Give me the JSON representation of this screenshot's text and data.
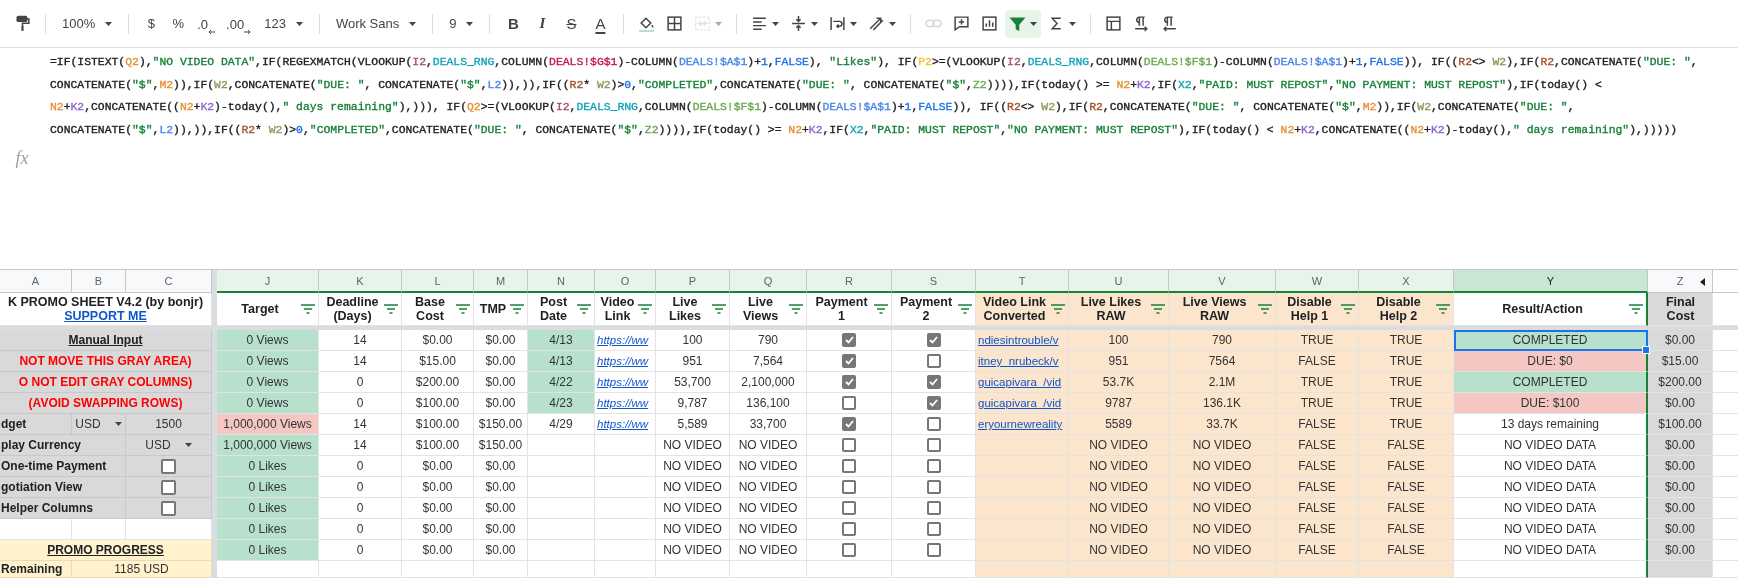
{
  "toolbar": [
    [
      {
        "kind": "paint-format"
      }
    ],
    [
      {
        "kind": "dropdown",
        "label": "100%"
      }
    ],
    [
      {
        "kind": "text",
        "label": "$"
      },
      {
        "kind": "text",
        "label": "%"
      },
      {
        "kind": "decimal-decrease",
        "label": ".0"
      },
      {
        "kind": "decimal-increase",
        "label": ".00"
      },
      {
        "kind": "dropdown",
        "label": "123"
      }
    ],
    [
      {
        "kind": "dropdown",
        "label": "Work Sans"
      }
    ],
    [
      {
        "kind": "dropdown",
        "label": "9"
      }
    ],
    [
      {
        "kind": "bold",
        "label": "B"
      },
      {
        "kind": "italic",
        "label": "I"
      },
      {
        "kind": "strike",
        "label": "S"
      },
      {
        "kind": "text-color",
        "label": "A"
      }
    ],
    [
      {
        "kind": "fill",
        "menu": false,
        "disabled": false
      },
      {
        "kind": "borders",
        "menu": false,
        "disabled": false
      },
      {
        "kind": "merge",
        "menu": true,
        "disabled": true
      }
    ],
    [
      {
        "kind": "align",
        "menu": true,
        "disabled": false
      },
      {
        "kind": "valign",
        "menu": true,
        "disabled": false
      },
      {
        "kind": "wrap",
        "menu": true,
        "disabled": false
      },
      {
        "kind": "rotate",
        "menu": true,
        "disabled": false
      }
    ],
    [
      {
        "kind": "link",
        "menu": false,
        "disabled": true,
        "active": false
      },
      {
        "kind": "comment",
        "menu": false,
        "disabled": false,
        "active": false
      },
      {
        "kind": "chart",
        "menu": false,
        "disabled": false,
        "active": false
      },
      {
        "kind": "filter",
        "menu": true,
        "disabled": false,
        "active": true
      },
      {
        "kind": "sigma",
        "menu": true,
        "disabled": false,
        "active": false
      }
    ],
    [
      {
        "kind": "columns"
      },
      {
        "kind": "ltr"
      },
      {
        "kind": "rtl"
      }
    ]
  ],
  "formula_bar": {
    "label": "fx",
    "lines": [
      [
        {
          "text": "=IF(ISTEXT("
        },
        {
          "text": "Q2",
          "color": "#e69138"
        },
        {
          "text": "),"
        },
        {
          "text": "\"NO VIDEO DATA\"",
          "color": "#188038"
        },
        {
          "text": ",IF(REGEXMATCH(VLOOKUP("
        },
        {
          "text": "I2",
          "color": "#a64d79"
        },
        {
          "text": ","
        },
        {
          "text": "DEALS_RNG",
          "color": "#12a4b8"
        },
        {
          "text": ",COLUMN("
        },
        {
          "text": "DEALS!$G$1",
          "color": "#c2185b"
        },
        {
          "text": ")-COLUMN("
        },
        {
          "text": "DEALS!$A$1",
          "color": "#4a86e8"
        },
        {
          "text": ")+"
        },
        {
          "text": "1",
          "color": "#1a73e8"
        },
        {
          "text": ","
        },
        {
          "text": "FALSE",
          "color": "#1a73e8"
        },
        {
          "text": "), "
        },
        {
          "text": "\"Likes\"",
          "color": "#188038"
        },
        {
          "text": "), IF("
        },
        {
          "text": "P2",
          "color": "#f1c232"
        },
        {
          "text": ">=(VLOOKUP("
        },
        {
          "text": "I2",
          "color": "#a64d79"
        },
        {
          "text": ","
        },
        {
          "text": "DEALS_RNG",
          "color": "#12a4b8"
        },
        {
          "text": ",COLUMN("
        },
        {
          "text": "DEALS!$F$1",
          "color": "#6aa84f"
        },
        {
          "text": ")-COLUMN("
        },
        {
          "text": "DEALS!$A$1",
          "color": "#4a86e8"
        },
        {
          "text": ")+"
        },
        {
          "text": "1",
          "color": "#1a73e8"
        },
        {
          "text": ","
        },
        {
          "text": "FALSE",
          "color": "#1a73e8"
        },
        {
          "text": ")), IF(("
        },
        {
          "text": "R2",
          "color": "#a0522d"
        },
        {
          "text": "<> "
        },
        {
          "text": "W2",
          "color": "#8a9a5b"
        },
        {
          "text": "),IF("
        },
        {
          "text": "R2",
          "color": "#a0522d"
        },
        {
          "text": ",CONCATENATE("
        },
        {
          "text": "\"DUE: \"",
          "color": "#188038"
        },
        {
          "text": ","
        }
      ],
      [
        {
          "text": "CONCATENATE("
        },
        {
          "text": "\"$\"",
          "color": "#188038"
        },
        {
          "text": ","
        },
        {
          "text": "M2",
          "color": "#e69138"
        },
        {
          "text": ")),IF("
        },
        {
          "text": "W2",
          "color": "#8a9a5b"
        },
        {
          "text": ",CONCATENATE("
        },
        {
          "text": "\"DUE: \"",
          "color": "#188038"
        },
        {
          "text": ", CONCATENATE("
        },
        {
          "text": "\"$\"",
          "color": "#188038"
        },
        {
          "text": ","
        },
        {
          "text": "L2",
          "color": "#4a86e8"
        },
        {
          "text": ")),)),IF(("
        },
        {
          "text": "R2",
          "color": "#a0522d"
        },
        {
          "text": "* "
        },
        {
          "text": "W2",
          "color": "#8a9a5b"
        },
        {
          "text": ")>"
        },
        {
          "text": "0",
          "color": "#1a73e8"
        },
        {
          "text": ","
        },
        {
          "text": "\"COMPLETED\"",
          "color": "#188038"
        },
        {
          "text": ",CONCATENATE("
        },
        {
          "text": "\"DUE: \"",
          "color": "#188038"
        },
        {
          "text": ", CONCATENATE("
        },
        {
          "text": "\"$\"",
          "color": "#188038"
        },
        {
          "text": ","
        },
        {
          "text": "Z2",
          "color": "#6aa84f"
        },
        {
          "text": ")))),IF(today() >= "
        },
        {
          "text": "N2",
          "color": "#e69138"
        },
        {
          "text": "+"
        },
        {
          "text": "K2",
          "color": "#8e63ce"
        },
        {
          "text": ",IF("
        },
        {
          "text": "X2",
          "color": "#12a4b8"
        },
        {
          "text": ","
        },
        {
          "text": "\"PAID: MUST REPOST\"",
          "color": "#188038"
        },
        {
          "text": ","
        },
        {
          "text": "\"NO PAYMENT: MUST REPOST\"",
          "color": "#188038"
        },
        {
          "text": "),IF(today() <"
        }
      ],
      [
        {
          "text": "N2",
          "color": "#e69138"
        },
        {
          "text": "+"
        },
        {
          "text": "K2",
          "color": "#8e63ce"
        },
        {
          "text": ",CONCATENATE(("
        },
        {
          "text": "N2",
          "color": "#e69138"
        },
        {
          "text": "+"
        },
        {
          "text": "K2",
          "color": "#8e63ce"
        },
        {
          "text": ")-today(),"
        },
        {
          "text": "\" days remaining\"",
          "color": "#188038"
        },
        {
          "text": "),))), IF("
        },
        {
          "text": "Q2",
          "color": "#e69138"
        },
        {
          "text": ">=(VLOOKUP("
        },
        {
          "text": "I2",
          "color": "#a64d79"
        },
        {
          "text": ","
        },
        {
          "text": "DEALS_RNG",
          "color": "#12a4b8"
        },
        {
          "text": ",COLUMN("
        },
        {
          "text": "DEALS!$F$1",
          "color": "#6aa84f"
        },
        {
          "text": ")-COLUMN("
        },
        {
          "text": "DEALS!$A$1",
          "color": "#4a86e8"
        },
        {
          "text": ")+"
        },
        {
          "text": "1",
          "color": "#1a73e8"
        },
        {
          "text": ","
        },
        {
          "text": "FALSE",
          "color": "#1a73e8"
        },
        {
          "text": ")), IF(("
        },
        {
          "text": "R2",
          "color": "#a0522d"
        },
        {
          "text": "<> "
        },
        {
          "text": "W2",
          "color": "#8a9a5b"
        },
        {
          "text": "),IF("
        },
        {
          "text": "R2",
          "color": "#a0522d"
        },
        {
          "text": ",CONCATENATE("
        },
        {
          "text": "\"DUE: \"",
          "color": "#188038"
        },
        {
          "text": ", CONCATENATE("
        },
        {
          "text": "\"$\"",
          "color": "#188038"
        },
        {
          "text": ","
        },
        {
          "text": "M2",
          "color": "#e69138"
        },
        {
          "text": ")),IF("
        },
        {
          "text": "W2",
          "color": "#8a9a5b"
        },
        {
          "text": ",CONCATENATE("
        },
        {
          "text": "\"DUE: \"",
          "color": "#188038"
        },
        {
          "text": ","
        }
      ],
      [
        {
          "text": "CONCATENATE("
        },
        {
          "text": "\"$\"",
          "color": "#188038"
        },
        {
          "text": ","
        },
        {
          "text": "L2",
          "color": "#4a86e8"
        },
        {
          "text": ")),)),IF(("
        },
        {
          "text": "R2",
          "color": "#a0522d"
        },
        {
          "text": "* "
        },
        {
          "text": "W2",
          "color": "#8a9a5b"
        },
        {
          "text": ")>"
        },
        {
          "text": "0",
          "color": "#1a73e8"
        },
        {
          "text": ","
        },
        {
          "text": "\"COMPLETED\"",
          "color": "#188038"
        },
        {
          "text": ",CONCATENATE("
        },
        {
          "text": "\"DUE: \"",
          "color": "#188038"
        },
        {
          "text": ", CONCATENATE("
        },
        {
          "text": "\"$\"",
          "color": "#188038"
        },
        {
          "text": ","
        },
        {
          "text": "Z2",
          "color": "#6aa84f"
        },
        {
          "text": ")))),IF(today() >= "
        },
        {
          "text": "N2",
          "color": "#e69138"
        },
        {
          "text": "+"
        },
        {
          "text": "K2",
          "color": "#8e63ce"
        },
        {
          "text": ",IF("
        },
        {
          "text": "X2",
          "color": "#12a4b8"
        },
        {
          "text": ","
        },
        {
          "text": "\"PAID: MUST REPOST\"",
          "color": "#188038"
        },
        {
          "text": ","
        },
        {
          "text": "\"NO PAYMENT: MUST REPOST\"",
          "color": "#188038"
        },
        {
          "text": "),IF(today() < "
        },
        {
          "text": "N2",
          "color": "#e69138"
        },
        {
          "text": "+"
        },
        {
          "text": "K2",
          "color": "#8e63ce"
        },
        {
          "text": ",CONCATENATE(("
        },
        {
          "text": "N2",
          "color": "#e69138"
        },
        {
          "text": "+"
        },
        {
          "text": "K2",
          "color": "#8e63ce"
        },
        {
          "text": ")-today(),"
        },
        {
          "text": "\" days remaining\"",
          "color": "#188038"
        },
        {
          "text": "),)))))"
        }
      ]
    ]
  },
  "sheet": {
    "left_columns": [
      {
        "letter": "A"
      },
      {
        "letter": "B"
      },
      {
        "letter": "C"
      }
    ],
    "title": "K PROMO SHEET V4.2 (by bonjr)",
    "support_link": "SUPPORT ME",
    "left_rows": [
      {
        "kind": "heading",
        "label": "Manual Input"
      },
      {
        "kind": "warning",
        "label": "NOT MOVE THIS GRAY AREA)"
      },
      {
        "kind": "warning",
        "label": "O NOT EDIT GRAY COLUMNS)"
      },
      {
        "kind": "warning",
        "label": "(AVOID SWAPPING ROWS)"
      },
      {
        "kind": "select-pair",
        "label": "dget",
        "choice": "USD",
        "value": "1500"
      },
      {
        "kind": "select",
        "label": "play Currency",
        "choice": "USD"
      },
      {
        "kind": "checkbox",
        "label": "One-time Payment",
        "checked": false
      },
      {
        "kind": "checkbox",
        "label": "gotiation View",
        "checked": false
      },
      {
        "kind": "checkbox",
        "label": "Helper Columns",
        "checked": false
      },
      {
        "kind": "blank"
      },
      {
        "kind": "section",
        "label": "PROMO PROGRESS"
      },
      {
        "kind": "total",
        "label": "Remaining",
        "value": "1185 USD"
      }
    ],
    "columns": [
      {
        "letter": "J",
        "title": "Target",
        "kind": "text",
        "helper": false,
        "locked": false,
        "filter": true,
        "filtered": true,
        "selected": false
      },
      {
        "letter": "K",
        "title": "Deadline (Days)",
        "kind": "text",
        "helper": false,
        "locked": false,
        "filter": true,
        "filtered": true,
        "selected": false
      },
      {
        "letter": "L",
        "title": "Base Cost",
        "kind": "text",
        "helper": false,
        "locked": false,
        "filter": true,
        "filtered": true,
        "selected": false
      },
      {
        "letter": "M",
        "title": "TMP",
        "kind": "text",
        "helper": false,
        "locked": false,
        "filter": true,
        "filtered": true,
        "selected": false
      },
      {
        "letter": "N",
        "title": "Post Date",
        "kind": "text",
        "helper": false,
        "locked": false,
        "filter": true,
        "filtered": true,
        "selected": false
      },
      {
        "letter": "O",
        "title": "Video Link",
        "kind": "link",
        "helper": false,
        "locked": false,
        "filter": true,
        "filtered": true,
        "selected": false
      },
      {
        "letter": "P",
        "title": "Live Likes",
        "kind": "text",
        "helper": false,
        "locked": false,
        "filter": true,
        "filtered": true,
        "selected": false
      },
      {
        "letter": "Q",
        "title": "Live Views",
        "kind": "text",
        "helper": false,
        "locked": false,
        "filter": true,
        "filtered": true,
        "selected": false
      },
      {
        "letter": "R",
        "title": "Payment 1",
        "kind": "checkbox",
        "helper": false,
        "locked": false,
        "filter": true,
        "filtered": true,
        "selected": false
      },
      {
        "letter": "S",
        "title": "Payment 2",
        "kind": "checkbox",
        "helper": false,
        "locked": false,
        "filter": true,
        "filtered": true,
        "selected": false
      },
      {
        "letter": "T",
        "title": "Video Link Converted",
        "kind": "link",
        "helper": true,
        "locked": false,
        "filter": true,
        "filtered": true,
        "selected": false
      },
      {
        "letter": "U",
        "title": "Live Likes RAW",
        "kind": "text",
        "helper": true,
        "locked": false,
        "filter": true,
        "filtered": true,
        "selected": false
      },
      {
        "letter": "V",
        "title": "Live Views RAW",
        "kind": "text",
        "helper": true,
        "locked": false,
        "filter": true,
        "filtered": true,
        "selected": false
      },
      {
        "letter": "W",
        "title": "Disable Help 1",
        "kind": "text",
        "helper": true,
        "locked": false,
        "filter": true,
        "filtered": true,
        "selected": false
      },
      {
        "letter": "X",
        "title": "Disable Help 2",
        "kind": "text",
        "helper": true,
        "locked": false,
        "filter": true,
        "filtered": true,
        "selected": false
      },
      {
        "letter": "Y",
        "title": "Result/Action",
        "kind": "text",
        "helper": false,
        "locked": false,
        "filter": true,
        "filtered": true,
        "selected": true
      },
      {
        "letter": "Z",
        "title": "Final Cost",
        "kind": "text",
        "helper": false,
        "locked": true,
        "filter": false,
        "filtered": false,
        "selected": false
      }
    ],
    "hidden_columns_marker": true,
    "rows": [
      {
        "cells": [
          {
            "text": "0 Views",
            "color": "#b7e1cd"
          },
          "14",
          "$0.00",
          "$0.00",
          {
            "text": "4/13",
            "color": "#b7e1cd"
          },
          "https://ww",
          "100",
          "790",
          true,
          true,
          "ndiesintrouble/v",
          "100",
          "790",
          "TRUE",
          "TRUE",
          {
            "text": "COMPLETED",
            "color": "#b7e1cd",
            "selected": true
          },
          "$0.00"
        ]
      },
      {
        "cells": [
          {
            "text": "0 Views",
            "color": "#b7e1cd"
          },
          "14",
          "$15.00",
          "$0.00",
          {
            "text": "4/13",
            "color": "#b7e1cd"
          },
          "https://ww",
          "951",
          "7,564",
          true,
          false,
          "itney_nrubeck/v",
          "951",
          "7564",
          "FALSE",
          "TRUE",
          {
            "text": "DUE: $0",
            "color": "#f4c7c3",
            "selected": false
          },
          "$15.00"
        ]
      },
      {
        "cells": [
          {
            "text": "0 Views",
            "color": "#b7e1cd"
          },
          "0",
          "$200.00",
          "$0.00",
          {
            "text": "4/22",
            "color": "#b7e1cd"
          },
          "https://ww",
          "53,700",
          "2,100,000",
          true,
          true,
          "guicapivara_/vid",
          "53.7K",
          "2.1M",
          "TRUE",
          "TRUE",
          {
            "text": "COMPLETED",
            "color": "#b7e1cd",
            "selected": false
          },
          "$200.00"
        ]
      },
      {
        "cells": [
          {
            "text": "0 Views",
            "color": "#b7e1cd"
          },
          "0",
          "$100.00",
          "$0.00",
          {
            "text": "4/23",
            "color": "#b7e1cd"
          },
          "https://ww",
          "9,787",
          "136,100",
          false,
          true,
          "guicapivara_/vid",
          "9787",
          "136.1K",
          "TRUE",
          "TRUE",
          {
            "text": "DUE: $100",
            "color": "#f4c7c3",
            "selected": false
          },
          "$0.00"
        ]
      },
      {
        "cells": [
          {
            "text": "1,000,000 Views",
            "color": "#f4c7c3"
          },
          "14",
          "$100.00",
          "$150.00",
          "4/29",
          "https://ww",
          "5,589",
          "33,700",
          true,
          false,
          "eryournewreality",
          "5589",
          "33.7K",
          "FALSE",
          "TRUE",
          {
            "text": "13 days remaining",
            "selected": false
          },
          "$100.00"
        ]
      },
      {
        "cells": [
          {
            "text": "1,000,000 Views",
            "color": "#b7e1cd"
          },
          "14",
          "$100.00",
          "$150.00",
          null,
          null,
          "NO VIDEO",
          "NO VIDEO",
          false,
          false,
          null,
          "NO VIDEO",
          "NO VIDEO",
          "FALSE",
          "FALSE",
          {
            "text": "NO VIDEO DATA",
            "selected": false
          },
          "$0.00"
        ]
      },
      {
        "cells": [
          {
            "text": "0 Likes",
            "color": "#b7e1cd"
          },
          "0",
          "$0.00",
          "$0.00",
          null,
          null,
          "NO VIDEO",
          "NO VIDEO",
          false,
          false,
          null,
          "NO VIDEO",
          "NO VIDEO",
          "FALSE",
          "FALSE",
          {
            "text": "NO VIDEO DATA",
            "selected": false
          },
          "$0.00"
        ]
      },
      {
        "cells": [
          {
            "text": "0 Likes",
            "color": "#b7e1cd"
          },
          "0",
          "$0.00",
          "$0.00",
          null,
          null,
          "NO VIDEO",
          "NO VIDEO",
          false,
          false,
          null,
          "NO VIDEO",
          "NO VIDEO",
          "FALSE",
          "FALSE",
          {
            "text": "NO VIDEO DATA",
            "selected": false
          },
          "$0.00"
        ]
      },
      {
        "cells": [
          {
            "text": "0 Likes",
            "color": "#b7e1cd"
          },
          "0",
          "$0.00",
          "$0.00",
          null,
          null,
          "NO VIDEO",
          "NO VIDEO",
          false,
          false,
          null,
          "NO VIDEO",
          "NO VIDEO",
          "FALSE",
          "FALSE",
          {
            "text": "NO VIDEO DATA",
            "selected": false
          },
          "$0.00"
        ]
      },
      {
        "cells": [
          {
            "text": "0 Likes",
            "color": "#b7e1cd"
          },
          "0",
          "$0.00",
          "$0.00",
          null,
          null,
          "NO VIDEO",
          "NO VIDEO",
          false,
          false,
          null,
          "NO VIDEO",
          "NO VIDEO",
          "FALSE",
          "FALSE",
          {
            "text": "NO VIDEO DATA",
            "selected": false
          },
          "$0.00"
        ]
      },
      {
        "cells": [
          {
            "text": "0 Likes",
            "color": "#b7e1cd"
          },
          "0",
          "$0.00",
          "$0.00",
          null,
          null,
          "NO VIDEO",
          "NO VIDEO",
          false,
          false,
          null,
          "NO VIDEO",
          "NO VIDEO",
          "FALSE",
          "FALSE",
          {
            "text": "NO VIDEO DATA",
            "selected": false
          },
          "$0.00"
        ]
      }
    ]
  }
}
